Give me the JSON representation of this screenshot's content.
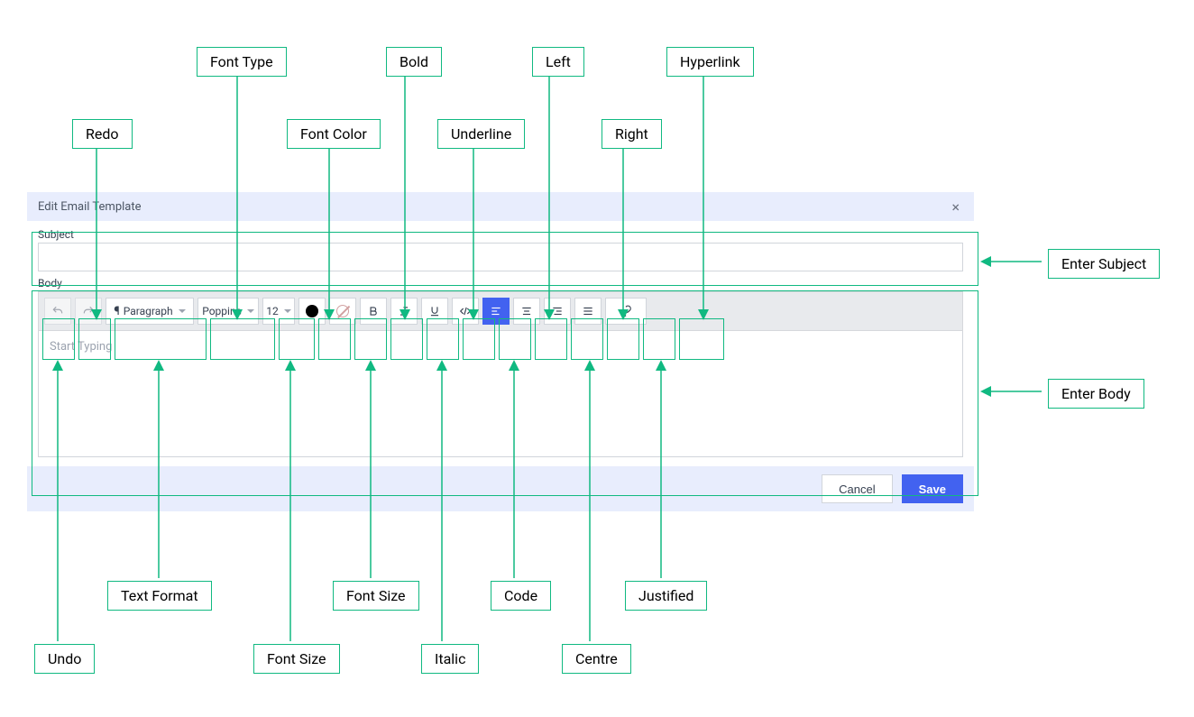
{
  "modal": {
    "title": "Edit Email Template",
    "subject_label": "Subject",
    "subject_value": "",
    "body_label": "Body",
    "body_placeholder": "Start Typing",
    "cancel_label": "Cancel",
    "save_label": "Save"
  },
  "toolbar": {
    "format_label": "Paragraph",
    "font_label": "Poppins",
    "size_label": "12"
  },
  "callouts": {
    "redo": "Redo",
    "font_type": "Font Type",
    "font_color": "Font Color",
    "bold": "Bold",
    "underline": "Underline",
    "left": "Left",
    "right": "Right",
    "hyperlink": "Hyperlink",
    "enter_subject": "Enter Subject",
    "enter_body": "Enter Body",
    "undo": "Undo",
    "text_format": "Text Format",
    "font_size": "Font Size",
    "font_size2": "Font Size",
    "italic": "Italic",
    "code": "Code",
    "centre": "Centre",
    "justified": "Justified"
  }
}
